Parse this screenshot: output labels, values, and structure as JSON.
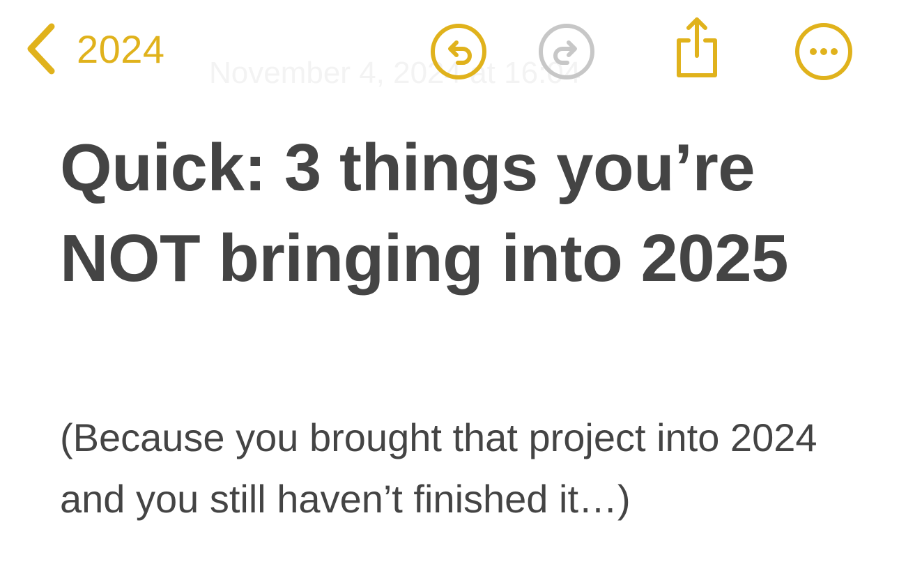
{
  "app": {
    "accent_color": "#e0b21c",
    "disabled_color": "#c7c7c7",
    "text_color": "#444444"
  },
  "toolbar": {
    "back_label": "2024",
    "back_icon": "chevron-left-icon",
    "undo_icon": "undo-icon",
    "redo_icon": "redo-icon",
    "redo_enabled": false,
    "share_icon": "share-icon",
    "more_icon": "ellipsis-circle-icon"
  },
  "note": {
    "date_watermark": "November 4, 2024 at 16:04",
    "title": "Quick: 3 things you’re NOT bringing into 2025",
    "subtitle": "(Because you brought that project into 2024 and you still haven’t finished it…)"
  }
}
